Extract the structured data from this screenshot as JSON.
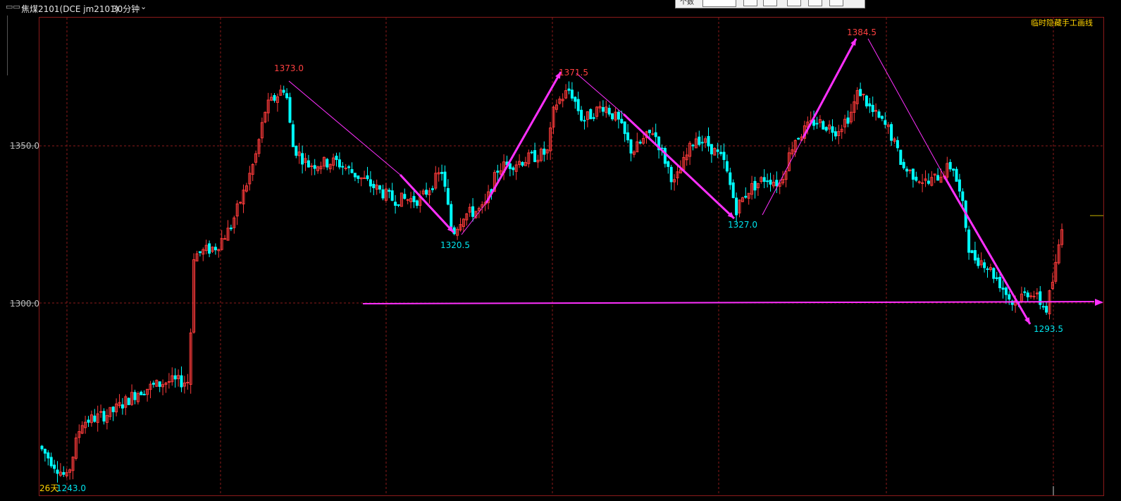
{
  "header": {
    "symbol_label": "焦煤2101(DCE jm2101)",
    "period_label": "30分钟"
  },
  "popup": {
    "label": "个数"
  },
  "hide_lines_label": "临时隐藏手工画线",
  "price_axis": [
    "1350.0",
    "1300.0"
  ],
  "annotations": {
    "day_count": "26天",
    "low_start": "1243.0",
    "peak1": "1373.0",
    "trough1": "1320.5",
    "peak2": "1371.5",
    "trough2": "1327.0",
    "peak3": "1384.5",
    "trough3": "1293.5"
  },
  "colors": {
    "up": "#ff3b3b",
    "down": "#00ffff",
    "trendline": "#ff30ff",
    "grid": "#8b1a1a",
    "label_red": "#ff4040",
    "label_cyan": "#00e5ee",
    "label_yellow": "#ffd200"
  },
  "chart_data": {
    "type": "candlestick",
    "period": "30分钟",
    "price_levels": [
      1350.0,
      1300.0
    ],
    "swing_points": [
      {
        "label": "1243.0",
        "price": 1243.0,
        "kind": "low"
      },
      {
        "label": "1373.0",
        "price": 1373.0,
        "kind": "high"
      },
      {
        "label": "1320.5",
        "price": 1320.5,
        "kind": "low"
      },
      {
        "label": "1371.5",
        "price": 1371.5,
        "kind": "high"
      },
      {
        "label": "1327.0",
        "price": 1327.0,
        "kind": "low"
      },
      {
        "label": "1384.5",
        "price": 1384.5,
        "kind": "high"
      },
      {
        "label": "1293.5",
        "price": 1293.5,
        "kind": "low"
      }
    ],
    "horizontal_line": 1300.0
  }
}
